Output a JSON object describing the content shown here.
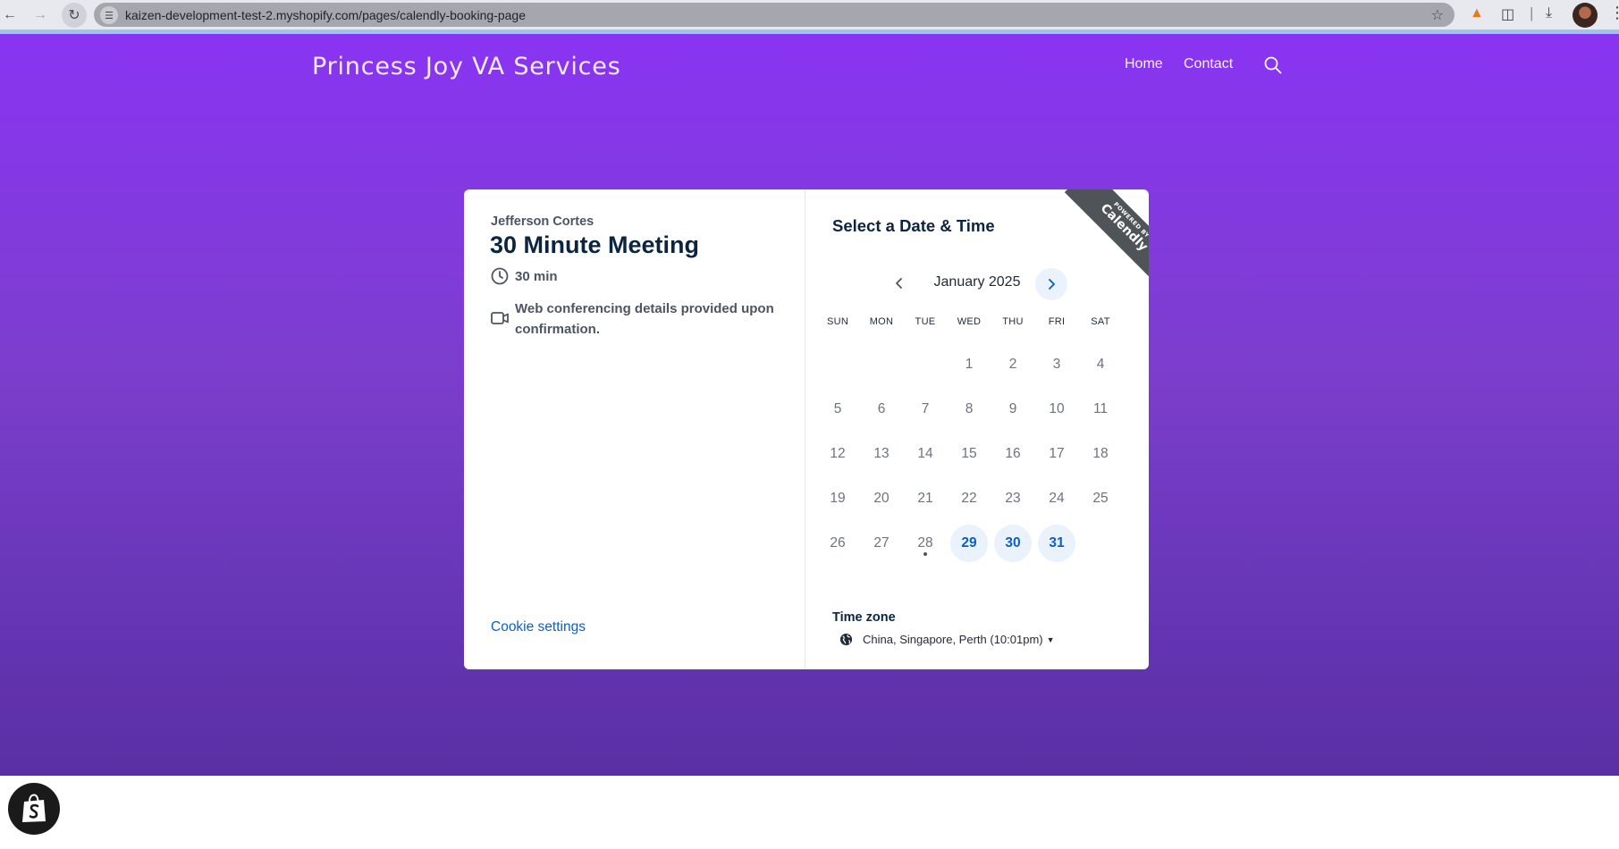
{
  "browser": {
    "url": "kaizen-development-test-2.myshopify.com/pages/calendly-booking-page"
  },
  "site": {
    "brand": "Princess Joy VA Services",
    "nav": {
      "home": "Home",
      "contact": "Contact"
    }
  },
  "booking": {
    "host": "Jefferson Cortes",
    "event_title": "30 Minute Meeting",
    "duration": "30 min",
    "conferencing": "Web conferencing details provided upon confirmation.",
    "cookie_settings": "Cookie settings"
  },
  "calendar": {
    "heading": "Select a Date & Time",
    "ribbon_small": "POWERED BY",
    "ribbon_big": "Calendly",
    "month": "January 2025",
    "weekdays": [
      "SUN",
      "MON",
      "TUE",
      "WED",
      "THU",
      "FRI",
      "SAT"
    ],
    "weeks": [
      [
        "",
        "",
        "",
        "1",
        "2",
        "3",
        "4"
      ],
      [
        "5",
        "6",
        "7",
        "8",
        "9",
        "10",
        "11"
      ],
      [
        "12",
        "13",
        "14",
        "15",
        "16",
        "17",
        "18"
      ],
      [
        "19",
        "20",
        "21",
        "22",
        "23",
        "24",
        "25"
      ],
      [
        "26",
        "27",
        "28",
        "29",
        "30",
        "31",
        ""
      ]
    ],
    "available_days": [
      "29",
      "30",
      "31"
    ],
    "today": "28",
    "timezone_label": "Time zone",
    "timezone_value": "China, Singapore, Perth (10:01pm)"
  },
  "colors": {
    "accent_blue": "#0c5fc6",
    "available_bg": "#eaf2fe",
    "page_gradient_top": "#8a34f3",
    "page_gradient_bottom": "#5a30a4"
  }
}
